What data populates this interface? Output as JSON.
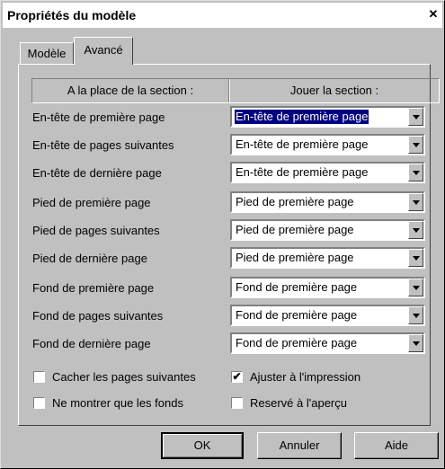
{
  "window": {
    "title": "Propriétés du modèle",
    "close_glyph": "✕"
  },
  "tabs": [
    {
      "label": "Modèle"
    },
    {
      "label": "Avancé",
      "active": true
    }
  ],
  "header": {
    "col1": "A la place de la section :",
    "col2": "Jouer la section :"
  },
  "rows": [
    {
      "label": "En-tête de première page",
      "value": "En-tête de première page"
    },
    {
      "label": "En-tête de pages suivantes",
      "value": "En-tête de première page"
    },
    {
      "label": "En-tête de dernière page",
      "value": "En-tête de première page"
    },
    {
      "label": "Pied de première page",
      "value": "Pied de première page"
    },
    {
      "label": "Pied de pages suivantes",
      "value": "Pied de première page"
    },
    {
      "label": "Pied de dernière page",
      "value": "Pied de première page"
    },
    {
      "label": "Fond de première page",
      "value": "Fond de première page"
    },
    {
      "label": "Fond de pages suivantes",
      "value": "Fond de première page"
    },
    {
      "label": "Fond de dernière page",
      "value": "Fond de première page"
    }
  ],
  "checkboxes": [
    {
      "label": "Cacher les pages suivantes",
      "checked": false
    },
    {
      "label": "Ajuster à l'impression",
      "checked": true
    },
    {
      "label": "Ne montrer que les fonds",
      "checked": false
    },
    {
      "label": "Reservé à l'aperçu",
      "checked": false
    }
  ],
  "buttons": {
    "ok": "OK",
    "cancel": "Annuler",
    "help": "Aide"
  },
  "colors": {
    "face": "#c0c0c0",
    "highlight_fill": "#000080"
  }
}
